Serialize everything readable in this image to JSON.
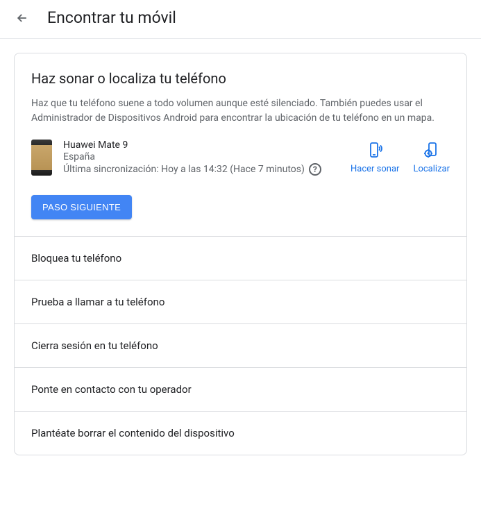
{
  "header": {
    "title": "Encontrar tu móvil"
  },
  "main": {
    "title": "Haz sonar o localiza tu teléfono",
    "description": "Haz que tu teléfono suene a todo volumen aunque esté silenciado. También puedes usar el Administrador de Dispositivos Android para encontrar la ubicación de tu teléfono en un mapa.",
    "device": {
      "name": "Huawei Mate 9",
      "location": "España",
      "last_sync": "Última sincronización: Hoy a las 14:32 (Hace 7 minutos)"
    },
    "actions": {
      "ring": "Hacer sonar",
      "locate": "Localizar"
    },
    "next_button": "PASO SIGUIENTE"
  },
  "steps": [
    "Bloquea tu teléfono",
    "Prueba a llamar a tu teléfono",
    "Cierra sesión en tu teléfono",
    "Ponte en contacto con tu operador",
    "Plantéate borrar el contenido del dispositivo"
  ]
}
